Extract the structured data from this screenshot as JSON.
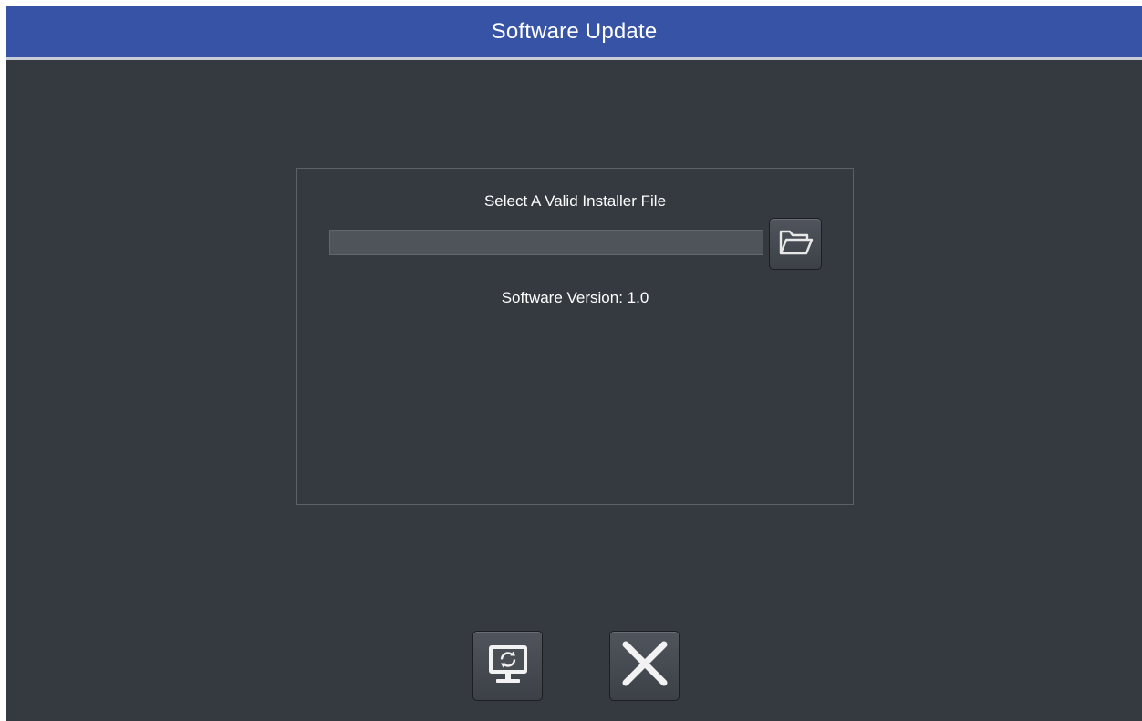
{
  "window": {
    "title": "Software Update"
  },
  "installer": {
    "heading": "Select A Valid Installer File",
    "file_path_value": "",
    "browse_icon": "folder-open-icon"
  },
  "version": {
    "text": "Software Version: 1.0"
  },
  "actions": {
    "update_icon": "monitor-refresh-icon",
    "close_icon": "close-x-icon"
  },
  "colors": {
    "titlebar": "#3653a6",
    "background": "#353940",
    "text": "#ffffff"
  }
}
